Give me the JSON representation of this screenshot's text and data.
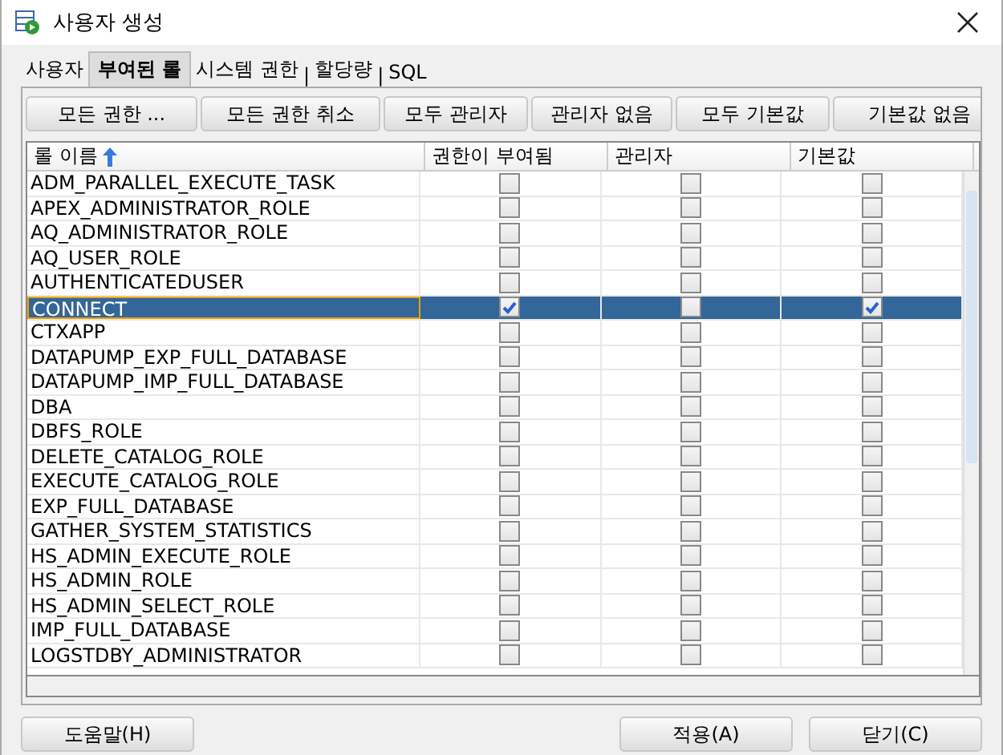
{
  "window": {
    "title": "사용자 생성"
  },
  "tabs": [
    {
      "kind": "tab",
      "label": "사용자",
      "selected": false
    },
    {
      "kind": "tab",
      "label": "부여된 롤",
      "selected": true
    },
    {
      "kind": "tab",
      "label": "시스템 권한",
      "selected": false
    },
    {
      "kind": "separator",
      "label": "|"
    },
    {
      "kind": "tab",
      "label": "할당량",
      "selected": false
    },
    {
      "kind": "separator",
      "label": "|"
    },
    {
      "kind": "tab",
      "label": "SQL",
      "selected": false
    }
  ],
  "toolbar": [
    "모든 권한 ...",
    "모든 권한 취소",
    "모두 관리자",
    "관리자 없음",
    "모두 기본값",
    "기본값 없음"
  ],
  "table": {
    "columns": [
      "롤 이름",
      "권한이 부여됨",
      "관리자",
      "기본값"
    ],
    "rows": [
      {
        "name": "ADM_PARALLEL_EXECUTE_TASK",
        "granted": false,
        "admin": false,
        "default": false,
        "selected": false
      },
      {
        "name": "APEX_ADMINISTRATOR_ROLE",
        "granted": false,
        "admin": false,
        "default": false,
        "selected": false
      },
      {
        "name": "AQ_ADMINISTRATOR_ROLE",
        "granted": false,
        "admin": false,
        "default": false,
        "selected": false
      },
      {
        "name": "AQ_USER_ROLE",
        "granted": false,
        "admin": false,
        "default": false,
        "selected": false
      },
      {
        "name": "AUTHENTICATEDUSER",
        "granted": false,
        "admin": false,
        "default": false,
        "selected": false
      },
      {
        "name": "CONNECT",
        "granted": true,
        "admin": false,
        "default": true,
        "selected": true
      },
      {
        "name": "CTXAPP",
        "granted": false,
        "admin": false,
        "default": false,
        "selected": false
      },
      {
        "name": "DATAPUMP_EXP_FULL_DATABASE",
        "granted": false,
        "admin": false,
        "default": false,
        "selected": false
      },
      {
        "name": "DATAPUMP_IMP_FULL_DATABASE",
        "granted": false,
        "admin": false,
        "default": false,
        "selected": false
      },
      {
        "name": "DBA",
        "granted": false,
        "admin": false,
        "default": false,
        "selected": false
      },
      {
        "name": "DBFS_ROLE",
        "granted": false,
        "admin": false,
        "default": false,
        "selected": false
      },
      {
        "name": "DELETE_CATALOG_ROLE",
        "granted": false,
        "admin": false,
        "default": false,
        "selected": false
      },
      {
        "name": "EXECUTE_CATALOG_ROLE",
        "granted": false,
        "admin": false,
        "default": false,
        "selected": false
      },
      {
        "name": "EXP_FULL_DATABASE",
        "granted": false,
        "admin": false,
        "default": false,
        "selected": false
      },
      {
        "name": "GATHER_SYSTEM_STATISTICS",
        "granted": false,
        "admin": false,
        "default": false,
        "selected": false
      },
      {
        "name": "HS_ADMIN_EXECUTE_ROLE",
        "granted": false,
        "admin": false,
        "default": false,
        "selected": false
      },
      {
        "name": "HS_ADMIN_ROLE",
        "granted": false,
        "admin": false,
        "default": false,
        "selected": false
      },
      {
        "name": "HS_ADMIN_SELECT_ROLE",
        "granted": false,
        "admin": false,
        "default": false,
        "selected": false
      },
      {
        "name": "IMP_FULL_DATABASE",
        "granted": false,
        "admin": false,
        "default": false,
        "selected": false
      },
      {
        "name": "LOGSTDBY_ADMINISTRATOR",
        "granted": false,
        "admin": false,
        "default": false,
        "selected": false
      }
    ]
  },
  "buttons": [
    "도움말(H)",
    "적용(A)",
    "닫기(C)"
  ]
}
